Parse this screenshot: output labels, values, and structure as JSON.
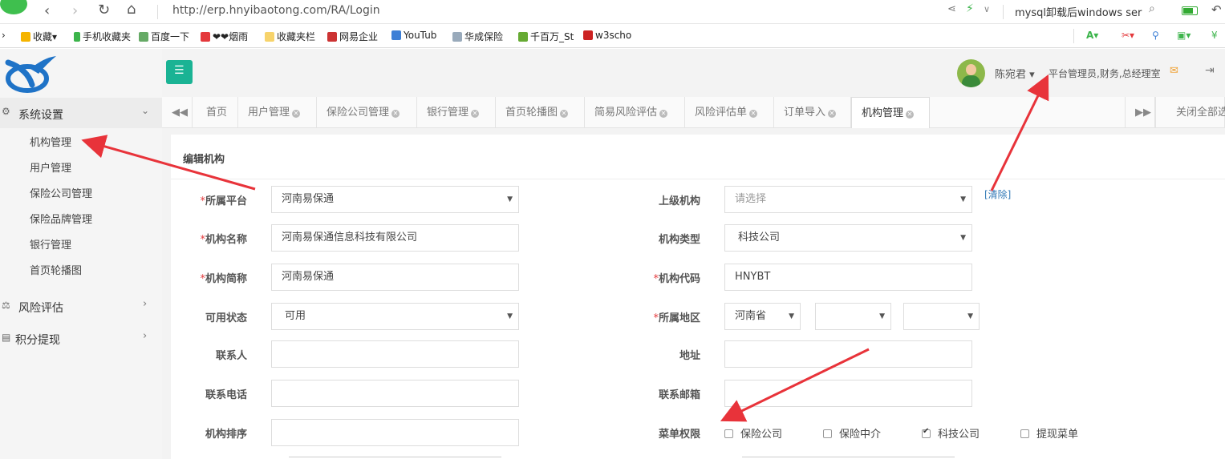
{
  "browser": {
    "url": "http://erp.hnyibaotong.com/RA/Login",
    "search_text": "mysql卸载后windows ser",
    "bookmarks": [
      "收藏",
      "手机收藏夹",
      "百度一下",
      "❤❤烟雨",
      "收藏夹栏",
      "网易企业",
      "YouTub",
      "华成保险",
      "千百万_St",
      "w3scho"
    ]
  },
  "sidebar": {
    "groups": [
      {
        "label": "系统设置",
        "expanded": true,
        "items": [
          "机构管理",
          "用户管理",
          "保险公司管理",
          "保险品牌管理",
          "银行管理",
          "首页轮播图"
        ]
      },
      {
        "label": "风险评估"
      },
      {
        "label": "积分提现"
      }
    ]
  },
  "header": {
    "user_name": "陈宛君",
    "roles": "平台管理员,财务,总经理室"
  },
  "tabs": {
    "items": [
      "首页",
      "用户管理",
      "保险公司管理",
      "银行管理",
      "首页轮播图",
      "简易风险评估",
      "风险评估单",
      "订单导入",
      "机构管理"
    ],
    "active": "机构管理",
    "close_all": "关闭全部选"
  },
  "form": {
    "title": "编辑机构",
    "platform": {
      "label": "所属平台",
      "value": "河南易保通"
    },
    "parent": {
      "label": "上级机构",
      "placeholder": "请选择",
      "clear": "[清除]"
    },
    "name": {
      "label": "机构名称",
      "value": "河南易保通信息科技有限公司"
    },
    "type": {
      "label": "机构类型",
      "value": "科技公司"
    },
    "short_name": {
      "label": "机构简称",
      "value": "河南易保通"
    },
    "code": {
      "label": "机构代码",
      "value": "HNYBT"
    },
    "status": {
      "label": "可用状态",
      "value": "可用"
    },
    "region": {
      "label": "所属地区",
      "province": "河南省",
      "city": "",
      "district": ""
    },
    "contact": {
      "label": "联系人",
      "value": ""
    },
    "address": {
      "label": "地址",
      "value": ""
    },
    "phone": {
      "label": "联系电话",
      "value": ""
    },
    "email": {
      "label": "联系邮箱",
      "value": ""
    },
    "sort": {
      "label": "机构排序",
      "value": ""
    },
    "menu_perms": {
      "label": "菜单权限",
      "options": [
        {
          "label": "保险公司",
          "checked": false
        },
        {
          "label": "保险中介",
          "checked": false
        },
        {
          "label": "科技公司",
          "checked": true
        },
        {
          "label": "提现菜单",
          "checked": false
        }
      ]
    }
  },
  "colors": {
    "menu_button": "#1ab394",
    "required": "#e4393c",
    "annotation_arrow": "#e8333a",
    "link": "#337ab7"
  }
}
